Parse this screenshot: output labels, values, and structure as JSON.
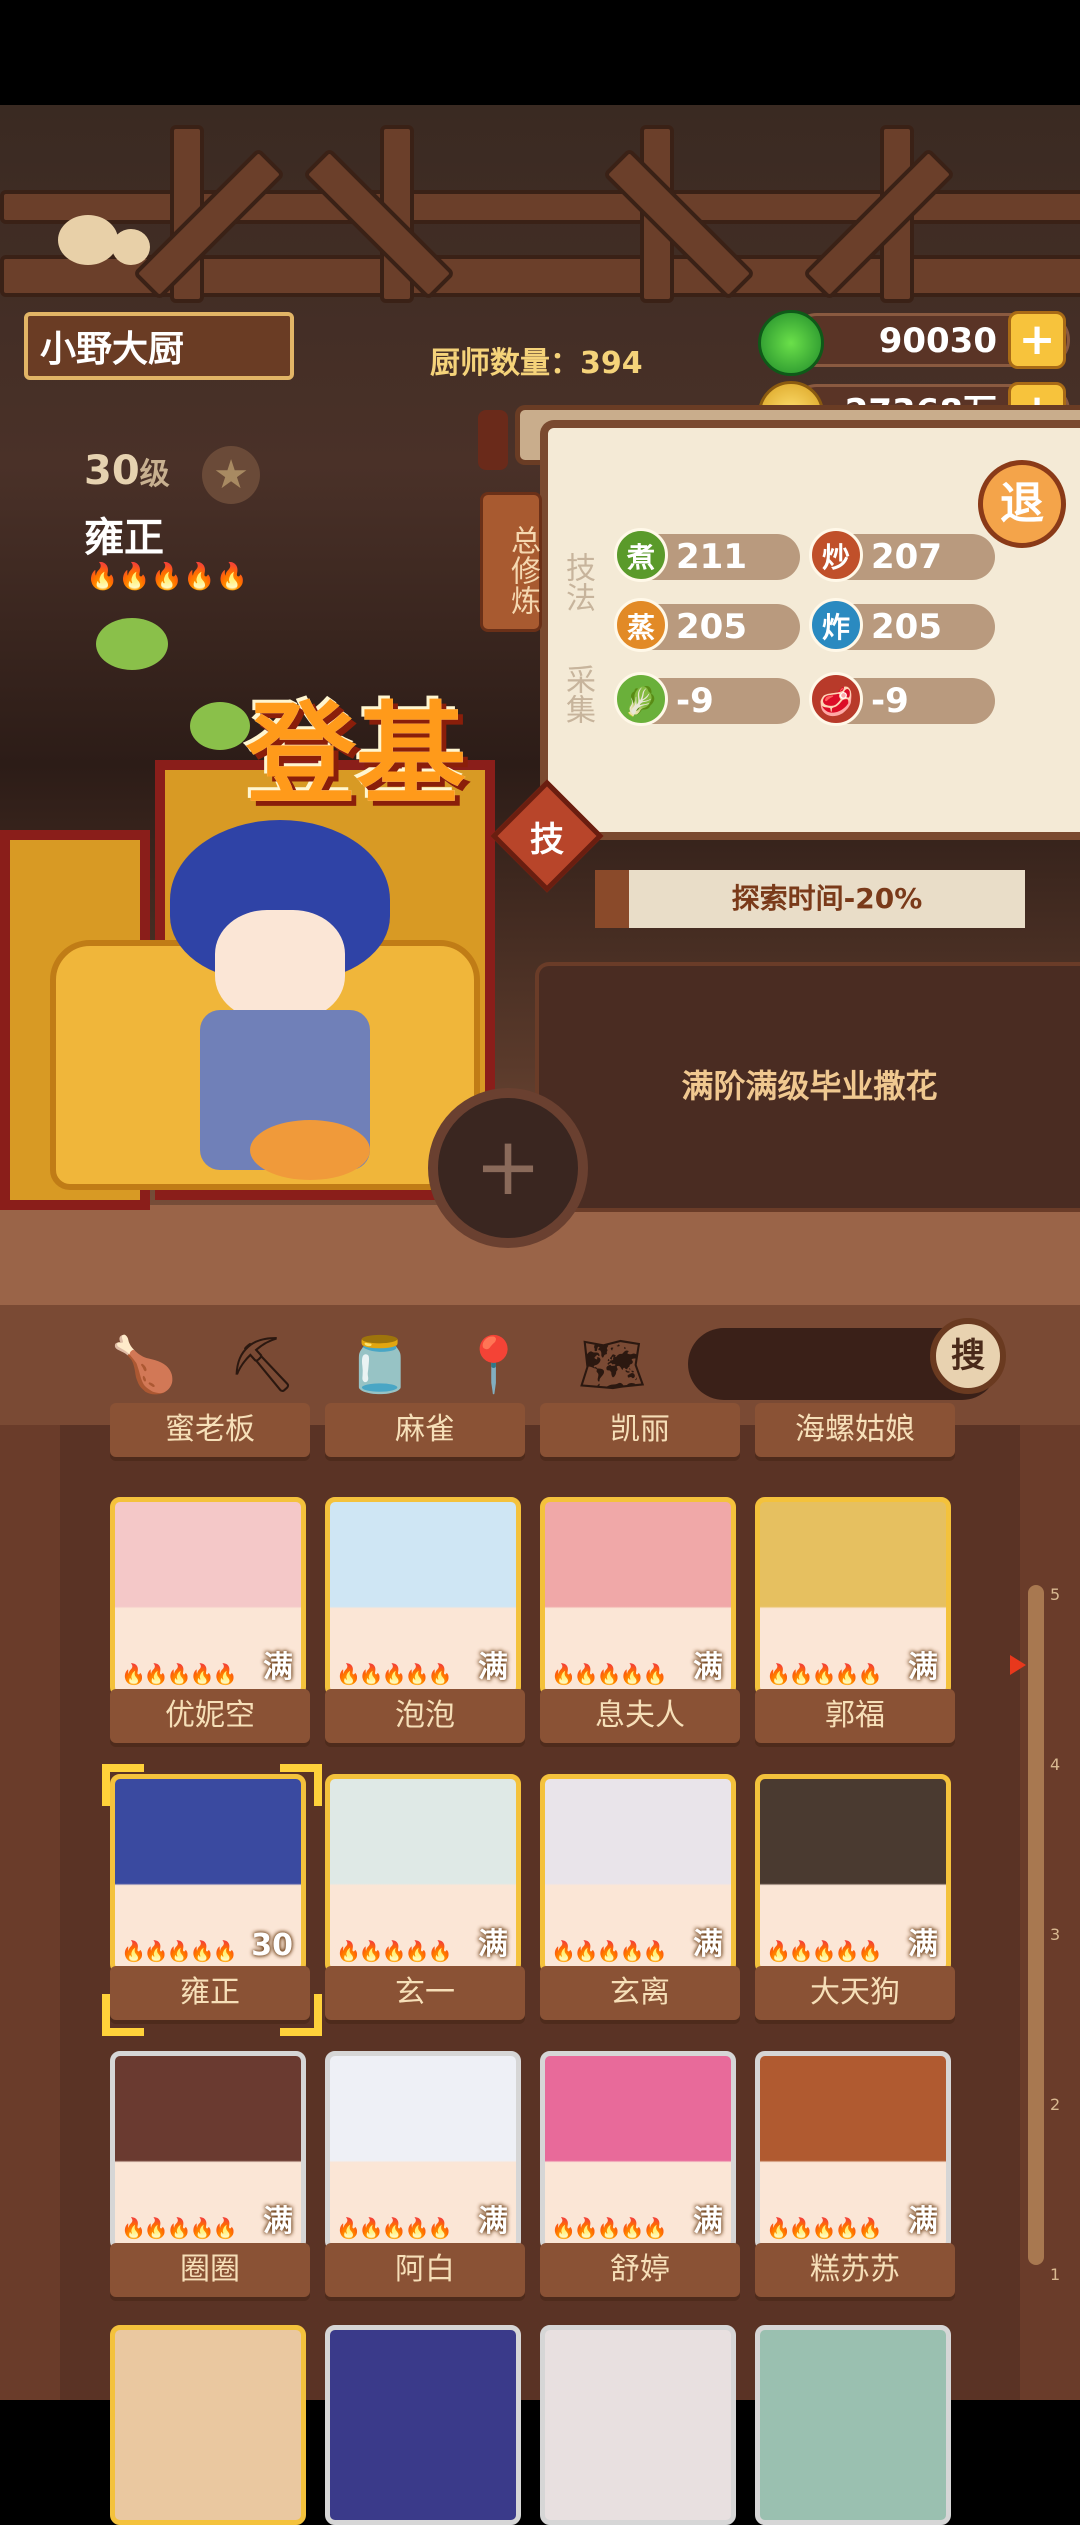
{
  "header": {
    "player_name": "小野大厨",
    "chef_count_label": "厨师数量：",
    "chef_count": "394",
    "jade": "90030",
    "coins": "27368万"
  },
  "chef": {
    "level": "30",
    "level_suffix": "级",
    "name": "雍正",
    "title_banner": "登基",
    "flames": "🔥🔥🔥🔥🔥"
  },
  "panel": {
    "side_tab": "总修炼",
    "exit_label": "退",
    "skill_label": "技法",
    "gather_label": "采集",
    "skill_badge": "技",
    "stats": [
      {
        "icon": "煮",
        "value": "211",
        "color": "#5a9a2a"
      },
      {
        "icon": "炒",
        "value": "207",
        "color": "#c0502a"
      },
      {
        "icon": "蒸",
        "value": "205",
        "color": "#e28a26"
      },
      {
        "icon": "炸",
        "value": "205",
        "color": "#2a8ac0"
      },
      {
        "icon": "",
        "value": "-9",
        "color": "#6ab03a"
      },
      {
        "icon": "",
        "value": "-9",
        "color": "#b83a2a"
      }
    ],
    "explore_bonus": "探索时间-20%",
    "note": "满阶满级毕业撒花",
    "add_label": "+"
  },
  "search": {
    "button": "搜"
  },
  "partial_row": [
    "蜜老板",
    "麻雀",
    "凯丽",
    "海螺姑娘"
  ],
  "chefs": [
    {
      "name": "优妮空",
      "badge": "满",
      "border": "gold",
      "tint": "#f4c8c8"
    },
    {
      "name": "泡泡",
      "badge": "满",
      "border": "gold",
      "tint": "#cfe6f4"
    },
    {
      "name": "息夫人",
      "badge": "满",
      "border": "gold",
      "tint": "#f0a8a8"
    },
    {
      "name": "郭福",
      "badge": "满",
      "border": "gold",
      "tint": "#e6c060"
    },
    {
      "name": "雍正",
      "badge": "30",
      "border": "gold",
      "tint": "#3a4aa0"
    },
    {
      "name": "玄一",
      "badge": "满",
      "border": "gold",
      "tint": "#dfe9e6"
    },
    {
      "name": "玄离",
      "badge": "满",
      "border": "gold",
      "tint": "#e9e4ea"
    },
    {
      "name": "大天狗",
      "badge": "满",
      "border": "gold",
      "tint": "#4a3a30"
    },
    {
      "name": "圈圈",
      "badge": "满",
      "border": "grey",
      "tint": "#6a3a30"
    },
    {
      "name": "阿白",
      "badge": "满",
      "border": "grey",
      "tint": "#eef0f6"
    },
    {
      "name": "舒婷",
      "badge": "满",
      "border": "grey",
      "tint": "#e86a9a"
    },
    {
      "name": "糕苏苏",
      "badge": "满",
      "border": "grey",
      "tint": "#b05a30"
    }
  ],
  "scale": [
    "5",
    "4",
    "3",
    "2",
    "1"
  ],
  "colors": {
    "gold": "#f4c23c",
    "wood": "#6b3f2a",
    "accent": "#e8381c"
  }
}
